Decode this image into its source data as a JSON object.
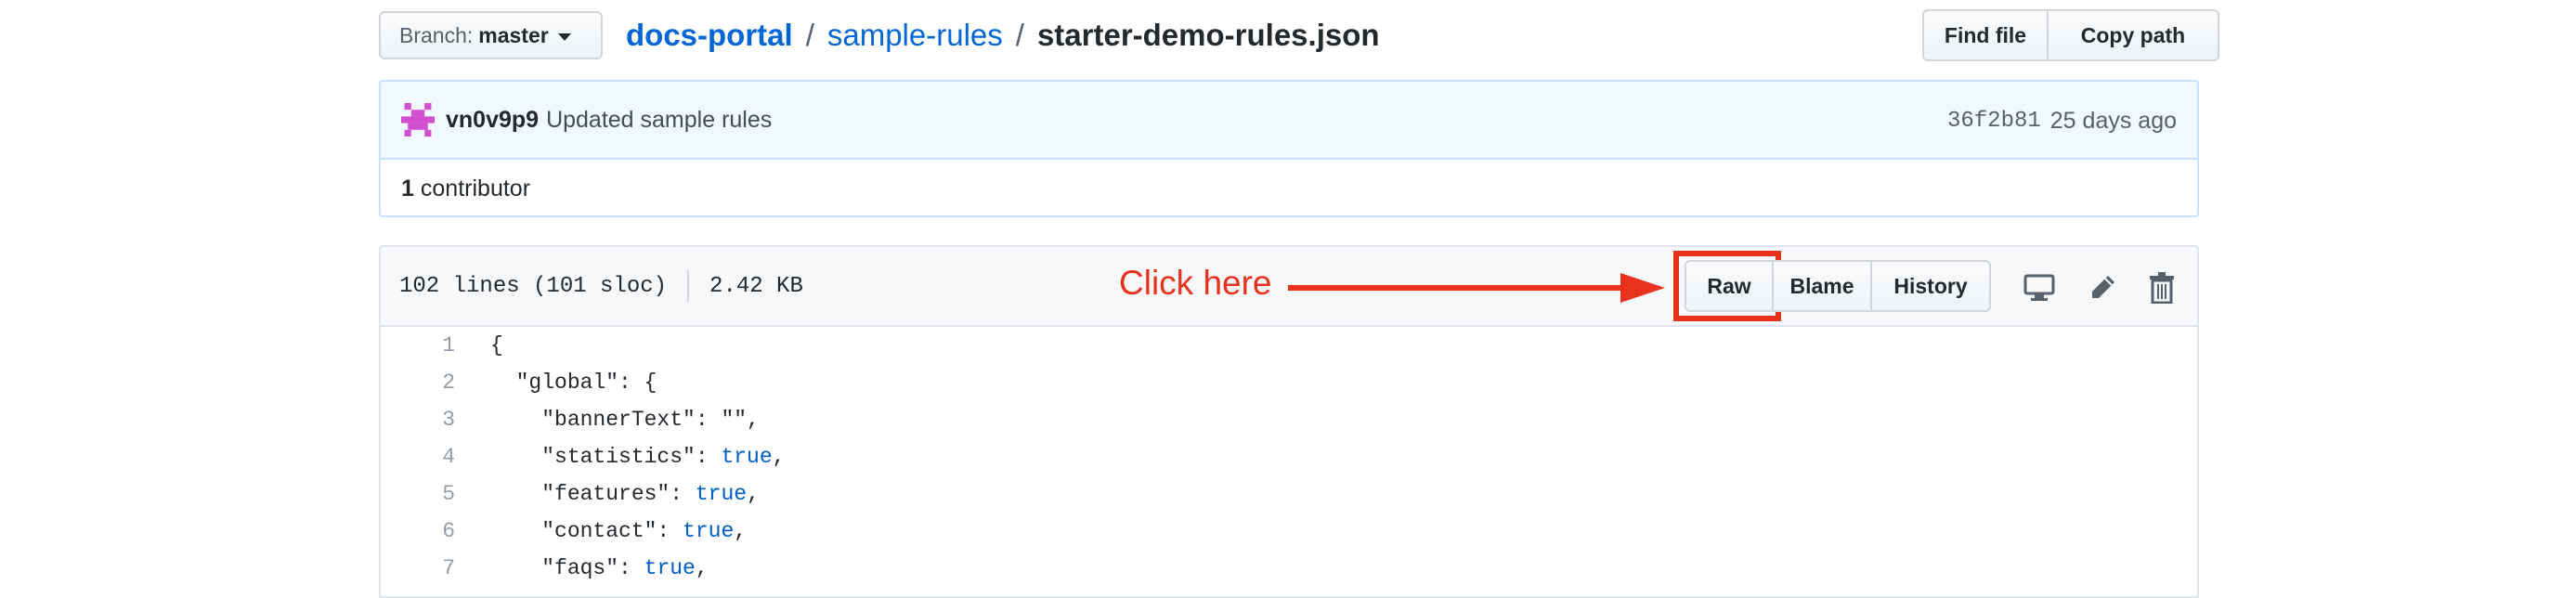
{
  "branch": {
    "label": "Branch:",
    "name": "master"
  },
  "breadcrumb": {
    "repo": "docs-portal",
    "directory": "sample-rules",
    "separator": "/",
    "file": "starter-demo-rules.json"
  },
  "top_actions": {
    "find_file": "Find file",
    "copy_path": "Copy path"
  },
  "commit": {
    "author": "vn0v9p9",
    "message": "Updated sample rules",
    "sha": "36f2b81",
    "age": "25 days ago",
    "avatar_color": "#d24fcf"
  },
  "contributors": {
    "count": "1",
    "label": "contributor"
  },
  "file": {
    "lines_info": "102 lines (101 sloc)",
    "size": "2.42 KB",
    "actions": {
      "raw": "Raw",
      "blame": "Blame",
      "history": "History"
    },
    "icons": [
      "desktop-icon",
      "pencil-icon",
      "trash-icon"
    ]
  },
  "annotation": {
    "text": "Click here",
    "color": "#e8321e"
  },
  "code_lines": [
    {
      "num": "1",
      "text": "{",
      "literal": "",
      "suffix": ""
    },
    {
      "num": "2",
      "text": "  \"global\": {",
      "literal": "",
      "suffix": ""
    },
    {
      "num": "3",
      "text": "    \"bannerText\": \"\",",
      "literal": "",
      "suffix": ""
    },
    {
      "num": "4",
      "text": "    \"statistics\": ",
      "literal": "true",
      "suffix": ","
    },
    {
      "num": "5",
      "text": "    \"features\": ",
      "literal": "true",
      "suffix": ","
    },
    {
      "num": "6",
      "text": "    \"contact\": ",
      "literal": "true",
      "suffix": ","
    },
    {
      "num": "7",
      "text": "    \"faqs\": ",
      "literal": "true",
      "suffix": ","
    }
  ]
}
